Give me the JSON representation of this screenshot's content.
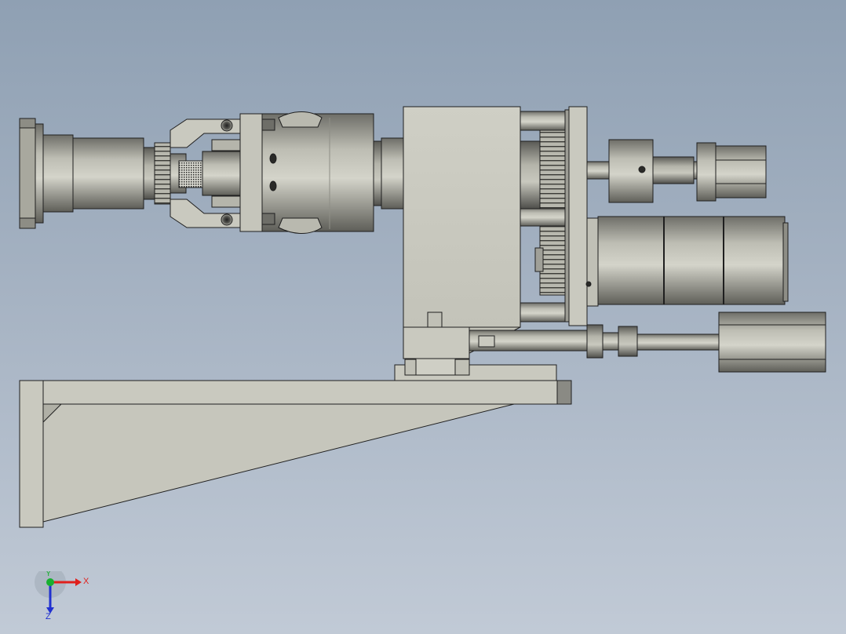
{
  "viewport": {
    "background_top": "#8fa0b3",
    "background_bottom": "#c1cad6"
  },
  "colors": {
    "body": "#c9c9bf",
    "body_shade": "#8e8e86",
    "body_dark": "#4a4a46",
    "edge": "#1f1f1f",
    "axis_x": "#e0201c",
    "axis_y": "#18b030",
    "axis_z": "#2030d0"
  },
  "triad": {
    "x_label": "X",
    "y_label": "Y",
    "z_label": "Z"
  }
}
